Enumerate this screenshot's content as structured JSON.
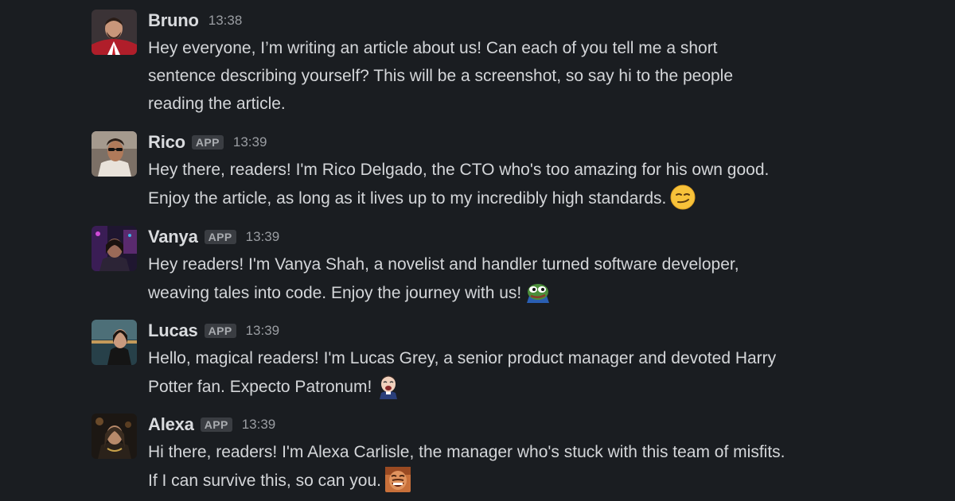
{
  "messages": [
    {
      "avatar": "bruno-avatar",
      "name": "Bruno",
      "badge": "",
      "time": "13:38",
      "lines": [
        "Hey everyone, I’m writing an article about us! Can each of you tell me a short",
        "sentence describing yourself? This will be a screenshot, so say hi to the people",
        "reading the article."
      ],
      "emoji": ""
    },
    {
      "avatar": "rico-avatar",
      "name": "Rico",
      "badge": "APP",
      "time": "13:39",
      "lines": [
        "Hey there, readers! I'm Rico Delgado, the CTO who's too amazing for his own good.",
        "Enjoy the article, as long as it lives up to my incredibly high standards."
      ],
      "emoji": "smirk-emoji"
    },
    {
      "avatar": "vanya-avatar",
      "name": "Vanya",
      "badge": "APP",
      "time": "13:39",
      "lines": [
        "Hey readers! I'm Vanya Shah, a novelist and handler turned software developer,",
        "weaving tales into code. Enjoy the journey with us!"
      ],
      "emoji": "pepe-emoji"
    },
    {
      "avatar": "lucas-avatar",
      "name": "Lucas",
      "badge": "APP",
      "time": "13:39",
      "lines": [
        "Hello, magical readers! I'm Lucas Grey, a senior product manager and devoted Harry",
        "Potter fan. Expecto Patronum!"
      ],
      "emoji": "laughing-person-emoji"
    },
    {
      "avatar": "alexa-avatar",
      "name": "Alexa",
      "badge": "APP",
      "time": "13:39",
      "lines": [
        "Hi there, readers! I'm Alexa Carlisle, the manager who's stuck with this team of misfits.",
        "If I can survive this, so can you."
      ],
      "emoji": "laughing-man-emoji"
    }
  ]
}
